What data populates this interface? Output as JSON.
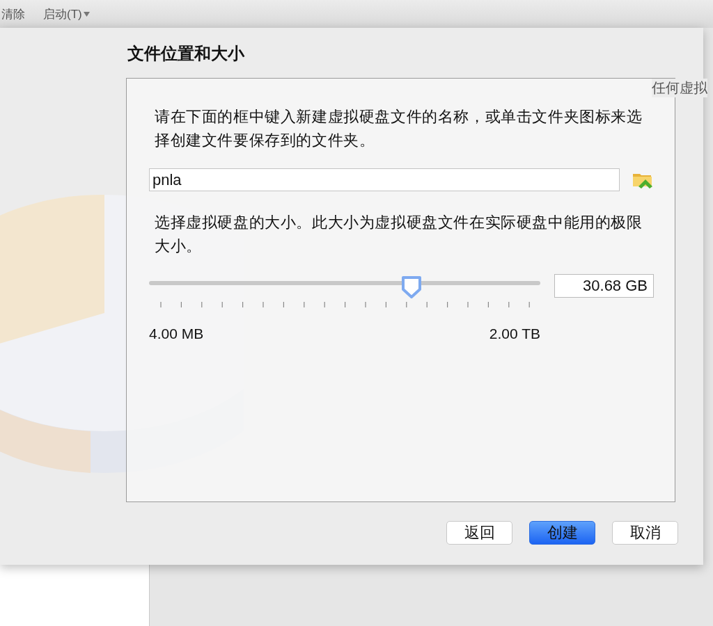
{
  "toolbar": {
    "items": [
      {
        "label": "清除",
        "kind": "button"
      },
      {
        "label": "启动(T)",
        "kind": "dropdown"
      }
    ]
  },
  "background_window": {
    "text": "任何虚拟"
  },
  "dialog": {
    "title": "文件位置和大小",
    "location_prompt": "请在下面的框中键入新建虚拟硬盘文件的名称，或单击文件夹图标来选择创建文件要保存到的文件夹。",
    "file_name": "pnla",
    "size_prompt": "选择虚拟硬盘的大小。此大小为虚拟硬盘文件在实际硬盘中能用的极限大小。",
    "size_slider": {
      "level": 0.67,
      "min_label": "4.00 MB",
      "max_label": "2.00 TB",
      "value": "30.68 GB"
    },
    "buttons": [
      {
        "label": "返回",
        "default": false
      },
      {
        "label": "创建",
        "default": true
      },
      {
        "label": "取消",
        "default": false
      }
    ]
  }
}
